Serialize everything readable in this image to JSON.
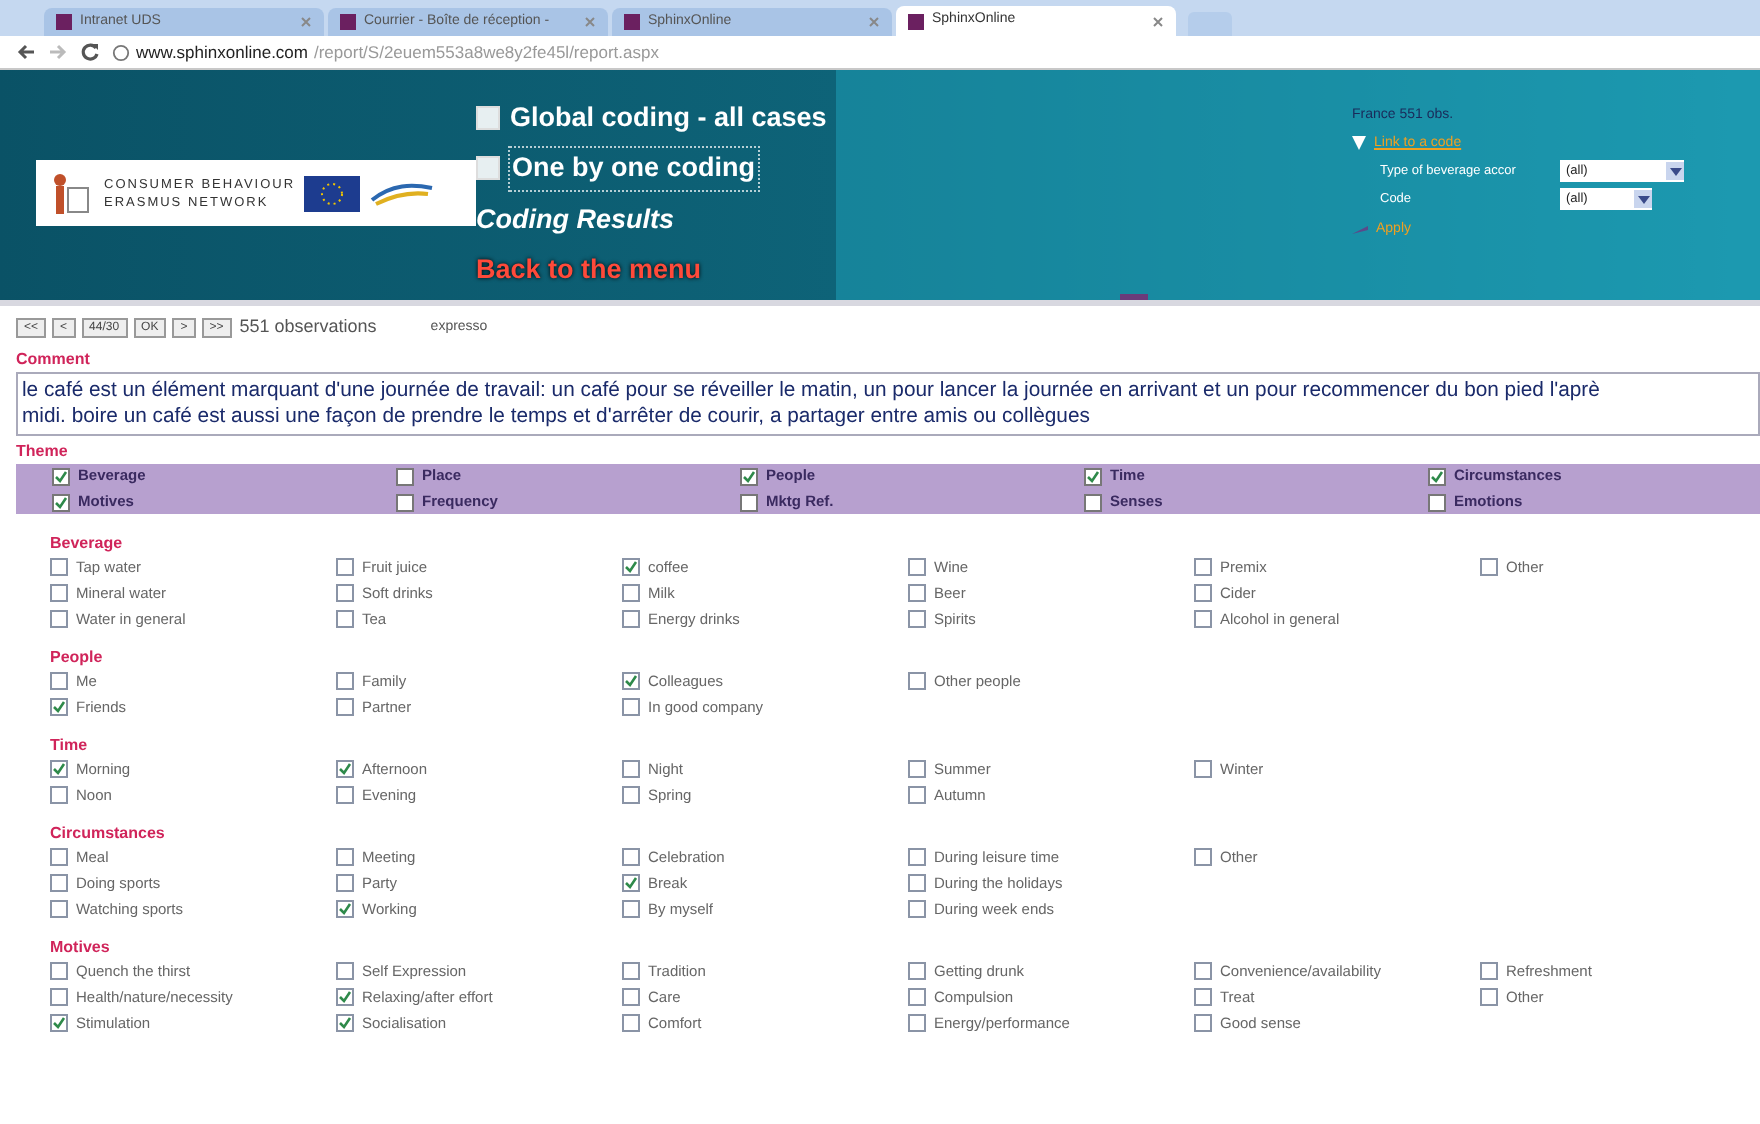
{
  "browser": {
    "tabs": [
      {
        "label": "Intranet UDS",
        "selected": false
      },
      {
        "label": "Courrier - Boîte de réception -",
        "selected": false
      },
      {
        "label": "SphinxOnline",
        "selected": false
      },
      {
        "label": "SphinxOnline",
        "selected": true
      }
    ],
    "url_host": "www.sphinxonline.com",
    "url_path": "/report/S/2euem553a8we8y2fe45l/report.aspx"
  },
  "header": {
    "logo": {
      "line_1": "CONSUMER BEHAVIOUR",
      "line_2": "ERASMUS NETWORK"
    },
    "menu": [
      {
        "label": "Global coding - all cases",
        "kind": "link",
        "focused": false
      },
      {
        "label": "One by one coding",
        "kind": "link",
        "focused": true
      },
      {
        "label": "Coding Results",
        "kind": "current",
        "focused": false
      },
      {
        "label": "Back to the menu",
        "kind": "back",
        "focused": false
      }
    ],
    "filter": {
      "title": "France 551 obs.",
      "link": "Link to a code",
      "fields": [
        {
          "label": "Type of beverage accor",
          "value": "(all)"
        },
        {
          "label": "Code",
          "value": "(all)"
        }
      ],
      "apply": "Apply"
    }
  },
  "nav": {
    "buttons": [
      "<<",
      "<",
      "44/30",
      "OK",
      ">",
      ">>"
    ],
    "count": "551 observations",
    "keyword": "expresso"
  },
  "comment": {
    "label": "Comment",
    "lines": [
      "le café est un élément marquant d'une journée de travail: un café pour se réveiller le matin, un pour lancer la journée en arrivant et un pour recommencer du bon pied l'aprè",
      "midi. boire un café est aussi une façon de prendre le temps et d'arrêter de courir, a partager entre amis ou collègues"
    ]
  },
  "theme": {
    "label": "Theme",
    "items": [
      {
        "label": "Beverage",
        "checked": true
      },
      {
        "label": "Place",
        "checked": false
      },
      {
        "label": "People",
        "checked": true
      },
      {
        "label": "Time",
        "checked": true
      },
      {
        "label": "Circumstances",
        "checked": true
      },
      {
        "label": "Motives",
        "checked": true
      },
      {
        "label": "Frequency",
        "checked": false
      },
      {
        "label": "Mktg Ref.",
        "checked": false
      },
      {
        "label": "Senses",
        "checked": false
      },
      {
        "label": "Emotions",
        "checked": false
      }
    ]
  },
  "sections": [
    {
      "title": "Beverage",
      "columns": [
        [
          {
            "label": "Tap water",
            "checked": false
          },
          {
            "label": "Mineral water",
            "checked": false
          },
          {
            "label": "Water in general",
            "checked": false
          }
        ],
        [
          {
            "label": "Fruit juice",
            "checked": false
          },
          {
            "label": "Soft drinks",
            "checked": false
          },
          {
            "label": "Tea",
            "checked": false
          }
        ],
        [
          {
            "label": "coffee",
            "checked": true
          },
          {
            "label": "Milk",
            "checked": false
          },
          {
            "label": "Energy drinks",
            "checked": false
          }
        ],
        [
          {
            "label": "Wine",
            "checked": false
          },
          {
            "label": "Beer",
            "checked": false
          },
          {
            "label": "Spirits",
            "checked": false
          }
        ],
        [
          {
            "label": "Premix",
            "checked": false
          },
          {
            "label": "Cider",
            "checked": false
          },
          {
            "label": "Alcohol in general",
            "checked": false
          }
        ],
        [
          {
            "label": "Other",
            "checked": false
          }
        ]
      ]
    },
    {
      "title": "People",
      "columns": [
        [
          {
            "label": "Me",
            "checked": false
          },
          {
            "label": "Friends",
            "checked": true
          }
        ],
        [
          {
            "label": "Family",
            "checked": false
          },
          {
            "label": "Partner",
            "checked": false
          }
        ],
        [
          {
            "label": "Colleagues",
            "checked": true
          },
          {
            "label": "In good company",
            "checked": false
          }
        ],
        [
          {
            "label": "Other people",
            "checked": false
          }
        ]
      ]
    },
    {
      "title": "Time",
      "columns": [
        [
          {
            "label": "Morning",
            "checked": true
          },
          {
            "label": "Noon",
            "checked": false
          }
        ],
        [
          {
            "label": "Afternoon",
            "checked": true
          },
          {
            "label": "Evening",
            "checked": false
          }
        ],
        [
          {
            "label": "Night",
            "checked": false
          },
          {
            "label": "Spring",
            "checked": false
          }
        ],
        [
          {
            "label": "Summer",
            "checked": false
          },
          {
            "label": "Autumn",
            "checked": false
          }
        ],
        [
          {
            "label": "Winter",
            "checked": false
          }
        ]
      ]
    },
    {
      "title": "Circumstances",
      "columns": [
        [
          {
            "label": "Meal",
            "checked": false
          },
          {
            "label": "Doing sports",
            "checked": false
          },
          {
            "label": "Watching sports",
            "checked": false
          }
        ],
        [
          {
            "label": "Meeting",
            "checked": false
          },
          {
            "label": "Party",
            "checked": false
          },
          {
            "label": "Working",
            "checked": true
          }
        ],
        [
          {
            "label": "Celebration",
            "checked": false
          },
          {
            "label": "Break",
            "checked": true
          },
          {
            "label": "By myself",
            "checked": false
          }
        ],
        [
          {
            "label": "During leisure time",
            "checked": false
          },
          {
            "label": "During the holidays",
            "checked": false
          },
          {
            "label": "During week ends",
            "checked": false
          }
        ],
        [
          {
            "label": "Other",
            "checked": false
          }
        ]
      ]
    },
    {
      "title": "Motives",
      "columns": [
        [
          {
            "label": "Quench the thirst",
            "checked": false
          },
          {
            "label": "Health/nature/necessity",
            "checked": false
          },
          {
            "label": "Stimulation",
            "checked": true
          }
        ],
        [
          {
            "label": "Self Expression",
            "checked": false
          },
          {
            "label": "Relaxing/after effort",
            "checked": true
          },
          {
            "label": "Socialisation",
            "checked": true
          }
        ],
        [
          {
            "label": "Tradition",
            "checked": false
          },
          {
            "label": "Care",
            "checked": false
          },
          {
            "label": "Comfort",
            "checked": false
          }
        ],
        [
          {
            "label": "Getting drunk",
            "checked": false
          },
          {
            "label": "Compulsion",
            "checked": false
          },
          {
            "label": "Energy/performance",
            "checked": false
          }
        ],
        [
          {
            "label": "Convenience/availability",
            "checked": false
          },
          {
            "label": "Treat",
            "checked": false
          },
          {
            "label": "Good sense",
            "checked": false
          }
        ],
        [
          {
            "label": "Refreshment",
            "checked": false
          },
          {
            "label": "Other",
            "checked": false
          }
        ]
      ]
    }
  ]
}
